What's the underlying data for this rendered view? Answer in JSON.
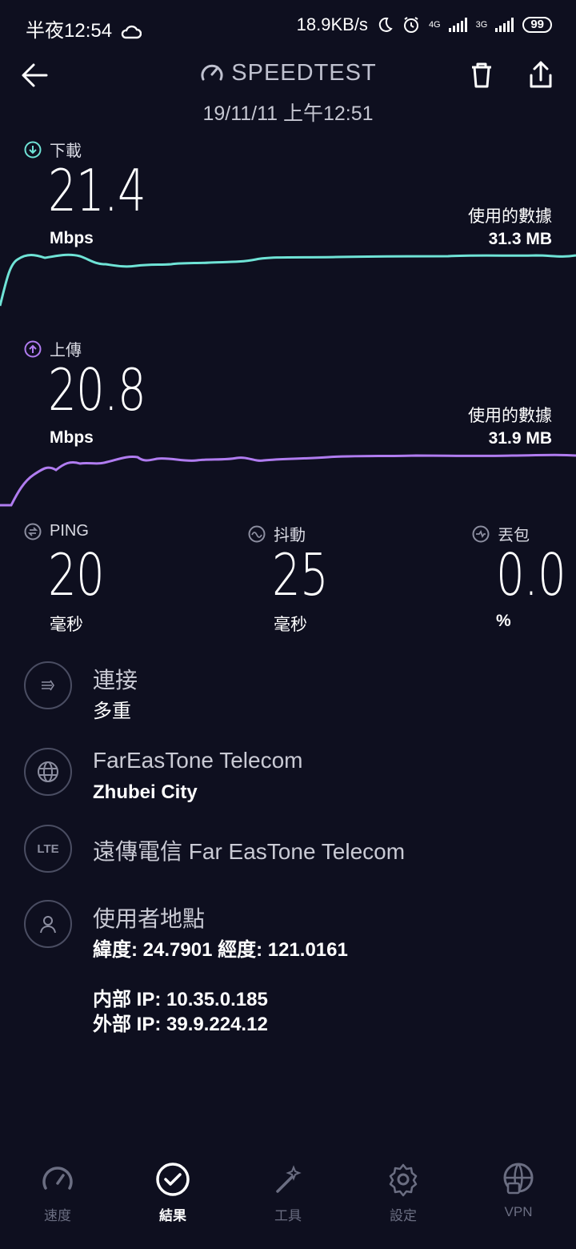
{
  "status": {
    "time": "半夜12:54",
    "speed": "18.9KB/s",
    "net1": "4G",
    "net2": "3G",
    "battery": "99"
  },
  "header": {
    "title": "SPEEDTEST",
    "date": "19/11/11 上午12:51"
  },
  "download": {
    "label": "下載",
    "value": "21.4",
    "unit": "Mbps",
    "data_label": "使用的數據",
    "data_value": "31.3 MB",
    "color": "#6fe3d6"
  },
  "upload": {
    "label": "上傳",
    "value": "20.8",
    "unit": "Mbps",
    "data_label": "使用的數據",
    "data_value": "31.9 MB",
    "color": "#b07cf0"
  },
  "stats": {
    "ping": {
      "label": "PING",
      "value": "20",
      "unit": "毫秒"
    },
    "jitter": {
      "label": "抖動",
      "value": "25",
      "unit": "毫秒"
    },
    "loss": {
      "label": "丟包",
      "value": "0.0",
      "unit": "%"
    }
  },
  "info": {
    "connection": {
      "title": "連接",
      "sub": "多重"
    },
    "server": {
      "title": "FarEasTone Telecom",
      "sub": "Zhubei City"
    },
    "provider": {
      "icon_text": "LTE",
      "title": "遠傳電信 Far EasTone Telecom"
    },
    "location": {
      "title": "使用者地點",
      "coords": "緯度: 24.7901 經度: 121.0161",
      "internal_ip": "内部 IP: 10.35.0.185",
      "external_ip": "外部 IP: 39.9.224.12"
    }
  },
  "nav": {
    "items": [
      {
        "label": "速度",
        "icon": "speed-gauge-icon"
      },
      {
        "label": "結果",
        "icon": "check-circle-icon"
      },
      {
        "label": "工具",
        "icon": "magic-wand-icon"
      },
      {
        "label": "設定",
        "icon": "gear-icon"
      },
      {
        "label": "VPN",
        "icon": "vpn-globe-lock-icon"
      }
    ],
    "active": "結果"
  }
}
